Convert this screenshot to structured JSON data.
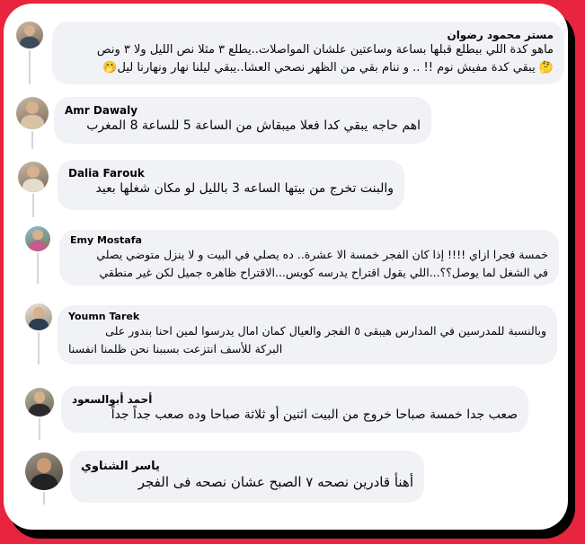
{
  "comments": [
    {
      "author": "مستر محمود رضوان",
      "lines": [
        "ماهو كدة اللي بيطلع قبلها بساعة وساعتين علشان المواصلات..يطلع ٣ مثلا نص الليل ولا ٣ ونص",
        "🤔 يبقي كدة مفيش نوم !! .. و ننام بقي من الظهر نصحي العشا..يبقي ليلنا نهار ونهارنا ليل🤭"
      ]
    },
    {
      "author": "Amr Dawaly",
      "lines": [
        "اهم حاجه يبقي كدا فعلا ميبقاش من الساعة 5 للساعة 8 المغرب"
      ]
    },
    {
      "author": "Dalia Farouk",
      "lines": [
        "والبنت تخرج من بيتها الساعه 3 بالليل لو مكان شغلها بعيد"
      ]
    },
    {
      "author": "Emy Mostafa",
      "lines": [
        "خمسة فجرا ازاي !!!! إذا كان الفجر خمسة الا عشرة.. ده يصلي في البيت و لا ينزل متوضي يصلي",
        "في الشغل لما يوصل؟؟...اللي يقول اقتراح يدرسه كويس...الاقتراح ظاهره جميل لكن غير منطقي"
      ]
    },
    {
      "author": "Youmn Tarek",
      "lines": [
        "وبالنسبة للمدرسين في المدارس هيبقى ٥ الفجر والعيال كمان امال يدرسوا لمين احنا بندور على",
        "البركة للأسف انتزعت بسببنا نحن ظلمنا انفسنا"
      ]
    },
    {
      "author": "أحمد أبوالسعود",
      "lines": [
        "صعب جدا خمسة صباحا خروج من البيت اثنين أو ثلاثة صباحا وده صعب جداً جداً"
      ]
    },
    {
      "author": "ياسر الشناوي",
      "lines": [
        "أهنأ قادرين نصحه ٧ الصبح عشان نصحه فى الفجر"
      ]
    }
  ]
}
